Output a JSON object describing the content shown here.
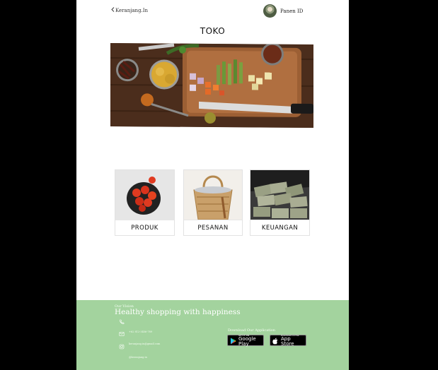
{
  "header": {
    "back_label": "Keranjang.In",
    "user_name": "Panen ID"
  },
  "page_title": "TOKO",
  "cards": [
    {
      "label": "PRODUK"
    },
    {
      "label": "PESANAN"
    },
    {
      "label": "KEUANGAN"
    }
  ],
  "footer": {
    "brand": "Our Vision",
    "tagline": "Healthy shopping  with happiness",
    "phone": "+62 812-3456-789",
    "email": "keranjang.in@gmail.com",
    "instagram": "@keranjang.in",
    "download_label": "Download Our Application",
    "google_play_small": "GET IT ON",
    "google_play_big": "Google Play",
    "app_store_small": "Download on the",
    "app_store_big": "App Store"
  },
  "colors": {
    "footer_bg": "#a3d39e",
    "backdrop": "#000000"
  },
  "icons": [
    "chevron-left-icon",
    "phone-icon",
    "mail-icon",
    "instagram-icon",
    "google-play-icon",
    "apple-icon"
  ]
}
